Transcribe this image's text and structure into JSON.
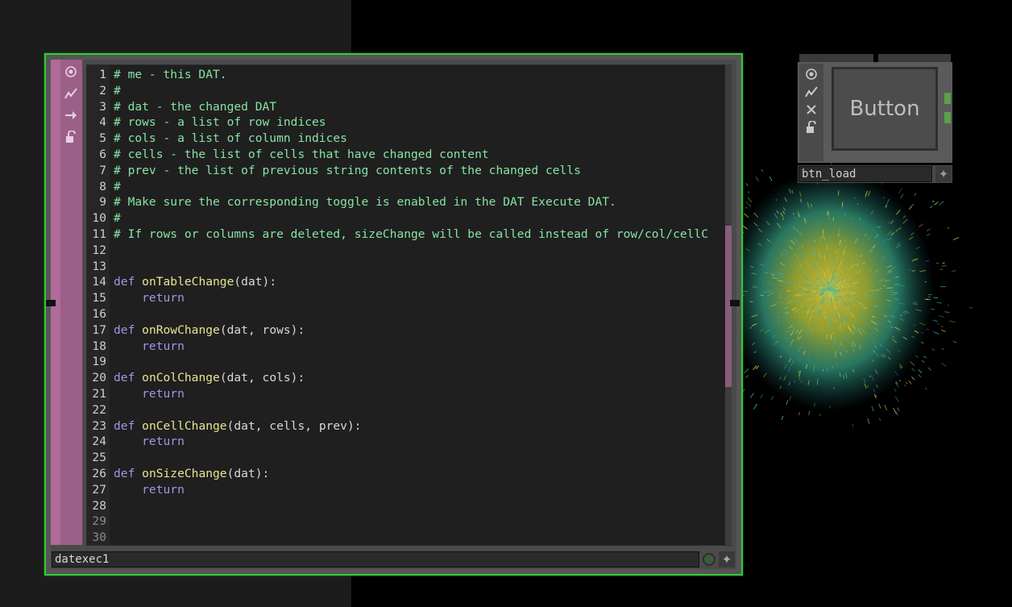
{
  "dat_node": {
    "name": "datexec1",
    "flags": [
      "viewer-flag-icon",
      "cook-flag-icon",
      "bypass-arrow-icon",
      "lock-icon"
    ],
    "code_lines": [
      {
        "n": "1",
        "parts": [
          [
            "c-com",
            "# me - this DAT."
          ]
        ]
      },
      {
        "n": "2",
        "parts": [
          [
            "c-com",
            "#"
          ]
        ]
      },
      {
        "n": "3",
        "parts": [
          [
            "c-com",
            "# dat - the changed DAT"
          ]
        ]
      },
      {
        "n": "4",
        "parts": [
          [
            "c-com",
            "# rows - a list of row indices"
          ]
        ]
      },
      {
        "n": "5",
        "parts": [
          [
            "c-com",
            "# cols - a list of column indices"
          ]
        ]
      },
      {
        "n": "6",
        "parts": [
          [
            "c-com",
            "# cells - the list of cells that have changed content"
          ]
        ]
      },
      {
        "n": "7",
        "parts": [
          [
            "c-com",
            "# prev - the list of previous string contents of the changed cells"
          ]
        ]
      },
      {
        "n": "8",
        "parts": [
          [
            "c-com",
            "#"
          ]
        ]
      },
      {
        "n": "9",
        "parts": [
          [
            "c-com",
            "# Make sure the corresponding toggle is enabled in the DAT Execute DAT."
          ]
        ]
      },
      {
        "n": "10",
        "parts": [
          [
            "c-com",
            "#"
          ]
        ]
      },
      {
        "n": "11",
        "parts": [
          [
            "c-com",
            "# If rows or columns are deleted, sizeChange will be called instead of row/col/cellC"
          ]
        ]
      },
      {
        "n": "12",
        "parts": []
      },
      {
        "n": "13",
        "parts": []
      },
      {
        "n": "14",
        "parts": [
          [
            "c-def",
            "def "
          ],
          [
            "c-fn",
            "onTableChange"
          ],
          [
            "c-txt",
            "(dat):"
          ]
        ]
      },
      {
        "n": "15",
        "parts": [
          [
            "c-ret",
            "    return"
          ]
        ]
      },
      {
        "n": "16",
        "parts": []
      },
      {
        "n": "17",
        "parts": [
          [
            "c-def",
            "def "
          ],
          [
            "c-fn",
            "onRowChange"
          ],
          [
            "c-txt",
            "(dat, rows):"
          ]
        ]
      },
      {
        "n": "18",
        "parts": [
          [
            "c-ret",
            "    return"
          ]
        ]
      },
      {
        "n": "19",
        "parts": []
      },
      {
        "n": "20",
        "parts": [
          [
            "c-def",
            "def "
          ],
          [
            "c-fn",
            "onColChange"
          ],
          [
            "c-txt",
            "(dat, cols):"
          ]
        ]
      },
      {
        "n": "21",
        "parts": [
          [
            "c-ret",
            "    return"
          ]
        ]
      },
      {
        "n": "22",
        "parts": []
      },
      {
        "n": "23",
        "parts": [
          [
            "c-def",
            "def "
          ],
          [
            "c-fn",
            "onCellChange"
          ],
          [
            "c-txt",
            "(dat, cells, prev):"
          ]
        ]
      },
      {
        "n": "24",
        "parts": [
          [
            "c-ret",
            "    return"
          ]
        ]
      },
      {
        "n": "25",
        "parts": []
      },
      {
        "n": "26",
        "parts": [
          [
            "c-def",
            "def "
          ],
          [
            "c-fn",
            "onSizeChange"
          ],
          [
            "c-txt",
            "(dat):"
          ]
        ]
      },
      {
        "n": "27",
        "parts": [
          [
            "c-ret",
            "    return"
          ]
        ]
      },
      {
        "n": "28",
        "parts": []
      },
      {
        "n": "29",
        "parts": [],
        "dim": true
      },
      {
        "n": "30",
        "parts": [],
        "dim": true
      }
    ],
    "menu_icon": "plus-star-icon"
  },
  "button_node": {
    "label": "Button",
    "name": "btn_load",
    "flags": [
      "viewer-flag-icon",
      "cook-flag-icon",
      "close-x-icon",
      "lock-icon"
    ],
    "menu_icon": "plus-star-icon"
  },
  "colors": {
    "selection_border": "#37c837",
    "comment": "#86e3a2",
    "keyword": "#9a98e8",
    "function": "#e6e690"
  }
}
